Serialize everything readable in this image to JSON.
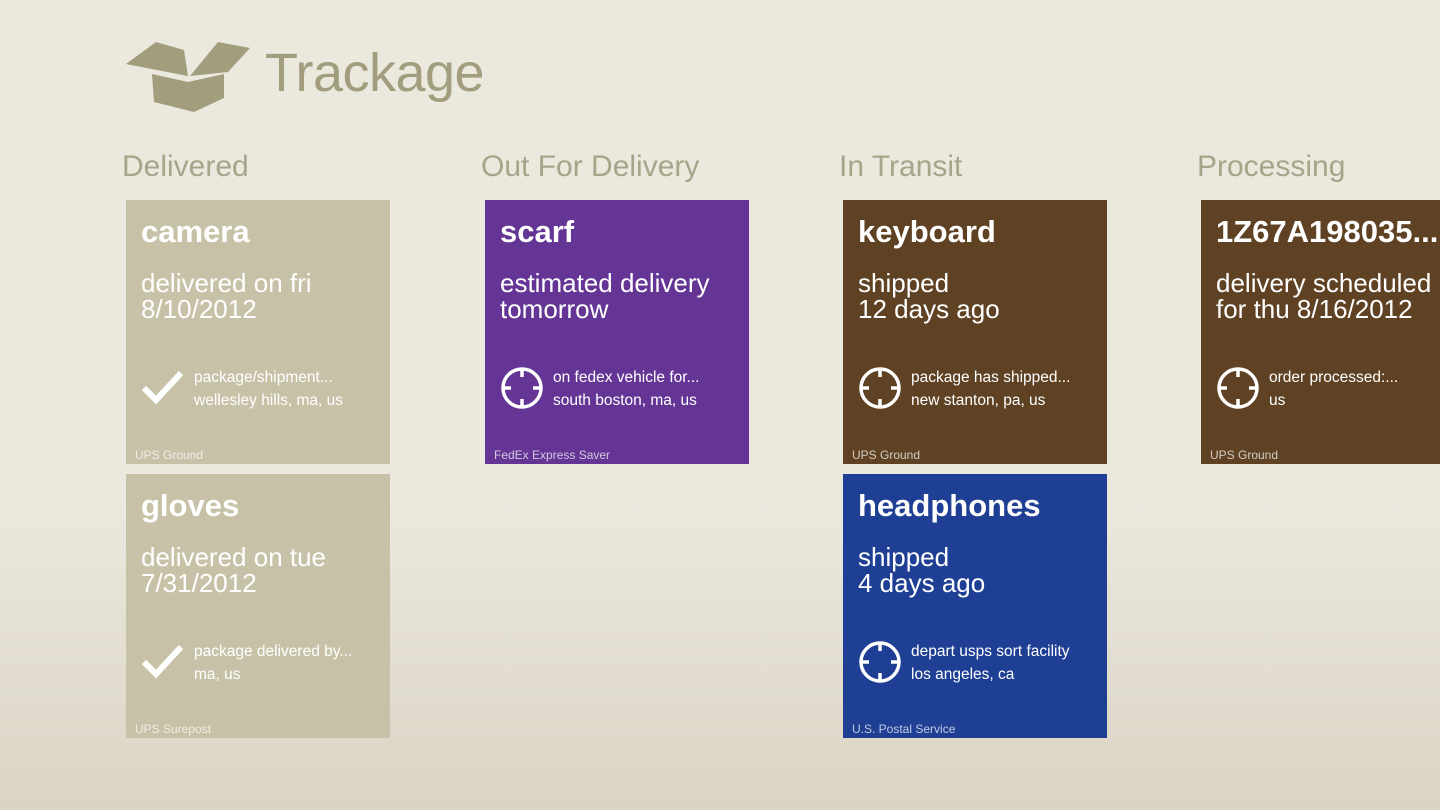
{
  "app": {
    "title": "Trackage"
  },
  "colors": {
    "delivered": "#c7c2a7",
    "out_for_delivery": "#643594",
    "in_transit": "#5e4223",
    "processing": "#5e4223",
    "usps_blue": "#1e3f93",
    "header": "#a19d7d"
  },
  "groups": [
    {
      "title": "Delivered",
      "packages": [
        {
          "name": "camera",
          "status_line1": "delivered on fri",
          "status_line2": "8/10/2012",
          "icon": "check-icon",
          "event_line1": "package/shipment...",
          "event_line2": "wellesley hills, ma, us",
          "carrier": "UPS  Ground",
          "color": "#c7c2a7"
        },
        {
          "name": "gloves",
          "status_line1": "delivered on tue",
          "status_line2": "7/31/2012",
          "icon": "check-icon",
          "event_line1": "package delivered by...",
          "event_line2": "ma, us",
          "carrier": "UPS  Surepost",
          "color": "#c7c2a7"
        }
      ]
    },
    {
      "title": "Out For Delivery",
      "packages": [
        {
          "name": "scarf",
          "status_line1": "estimated delivery",
          "status_line2": "tomorrow",
          "icon": "crosshair-icon",
          "event_line1": "on fedex vehicle for...",
          "event_line2": "south boston, ma, us",
          "carrier": "FedEx  Express Saver",
          "color": "#643594"
        }
      ]
    },
    {
      "title": "In Transit",
      "packages": [
        {
          "name": "keyboard",
          "status_line1": "shipped",
          "status_line2": "12 days ago",
          "icon": "crosshair-icon",
          "event_line1": "package has shipped...",
          "event_line2": "new stanton, pa, us",
          "carrier": "UPS  Ground",
          "color": "#5e4223"
        },
        {
          "name": "headphones",
          "status_line1": "shipped",
          "status_line2": "4 days ago",
          "icon": "crosshair-icon",
          "event_line1": "depart usps sort facility",
          "event_line2": "los angeles, ca",
          "carrier": "U.S. Postal Service",
          "color": "#1e3f93"
        }
      ]
    },
    {
      "title": "Processing",
      "packages": [
        {
          "name": "1Z67A198035...",
          "status_line1": "delivery scheduled",
          "status_line2": "for thu 8/16/2012",
          "icon": "crosshair-icon",
          "event_line1": "order processed:...",
          "event_line2": "us",
          "carrier": "UPS  Ground",
          "color": "#5e4223"
        }
      ]
    }
  ]
}
